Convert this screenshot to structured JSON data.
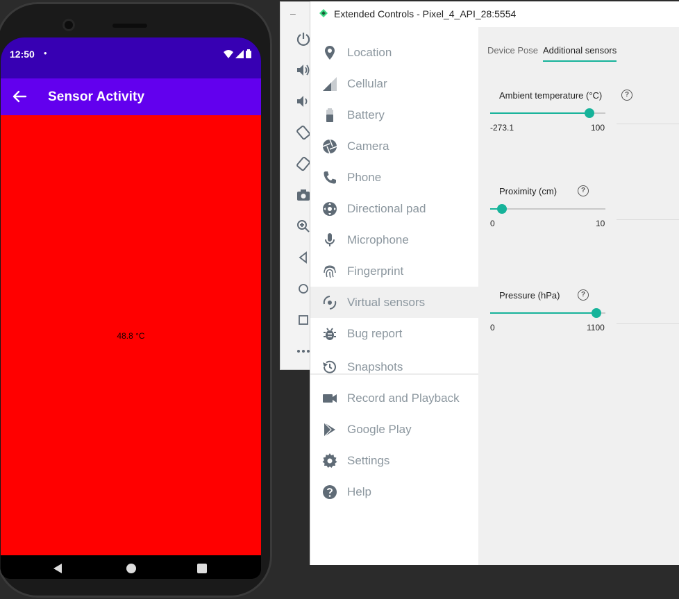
{
  "phone": {
    "status": {
      "time": "12:50",
      "dot": "•"
    },
    "appbar": {
      "title": "Sensor Activity"
    },
    "content": {
      "sensor_value": "48.8 °C",
      "background": "#ff0000"
    },
    "colors": {
      "status_bar": "#3700b3",
      "app_bar": "#6200ee"
    }
  },
  "toolbar": {
    "minimize": "–"
  },
  "extended_controls": {
    "title": "Extended Controls - Pixel_4_API_28:5554",
    "menu": [
      {
        "label": "Location",
        "icon": "location-pin-icon"
      },
      {
        "label": "Cellular",
        "icon": "cellular-signal-icon"
      },
      {
        "label": "Battery",
        "icon": "battery-icon"
      },
      {
        "label": "Camera",
        "icon": "camera-aperture-icon"
      },
      {
        "label": "Phone",
        "icon": "phone-icon"
      },
      {
        "label": "Directional pad",
        "icon": "dpad-icon"
      },
      {
        "label": "Microphone",
        "icon": "microphone-icon"
      },
      {
        "label": "Fingerprint",
        "icon": "fingerprint-icon"
      },
      {
        "label": "Virtual sensors",
        "icon": "virtual-sensors-icon",
        "active": true
      },
      {
        "label": "Bug report",
        "icon": "bug-icon"
      },
      {
        "label": "Snapshots",
        "icon": "history-icon"
      },
      {
        "label": "Record and Playback",
        "icon": "video-camera-icon"
      },
      {
        "label": "Google Play",
        "icon": "play-store-icon"
      },
      {
        "label": "Settings",
        "icon": "gear-icon"
      },
      {
        "label": "Help",
        "icon": "help-icon"
      }
    ],
    "tabs": [
      {
        "label": "Device Pose",
        "selected": false
      },
      {
        "label": "Additional sensors",
        "selected": true
      }
    ],
    "sensors": [
      {
        "label": "Ambient temperature (°C)",
        "min": "-273.1",
        "max": "100",
        "value": 48.8
      },
      {
        "label": "Proximity (cm)",
        "min": "0",
        "max": "10",
        "value": 1
      },
      {
        "label": "Pressure (hPa)",
        "min": "0",
        "max": "1100",
        "value": 1013.25
      }
    ],
    "help_glyph": "?",
    "accent": "#16b39a"
  }
}
